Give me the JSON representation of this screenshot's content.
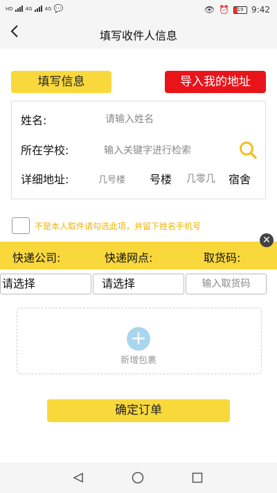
{
  "status_bar": {
    "time": "9:42",
    "battery": "19",
    "left_tags": [
      "HD",
      "4G",
      "4G"
    ]
  },
  "header": {
    "title": "填写收件人信息"
  },
  "tabs": {
    "fill_info": "填写信息",
    "import_address": "导入我的地址"
  },
  "form": {
    "name_label": "姓名:",
    "name_placeholder": "请输入姓名",
    "school_label": "所在学校:",
    "school_placeholder": "输入关键字进行检索",
    "address_label": "详细地址:",
    "building_placeholder": "几号楼",
    "building_suffix": "号楼",
    "room_placeholder": "几零几",
    "dorm_suffix": "宿舍"
  },
  "notice": {
    "text": "不是本人取件请勾选此项，并留下姓名手机号"
  },
  "express": {
    "company_label": "快递公司:",
    "outlet_label": "快递网点:",
    "code_label": "取货码:",
    "company_value": "请选择",
    "outlet_value": "请选择",
    "code_placeholder": "输入取货码"
  },
  "package": {
    "add_label": "新增包裹"
  },
  "submit": {
    "label": "确定订单"
  },
  "colors": {
    "accent_yellow": "#f9d83b",
    "accent_red": "#e8141a",
    "warning_text": "#f0b400"
  }
}
